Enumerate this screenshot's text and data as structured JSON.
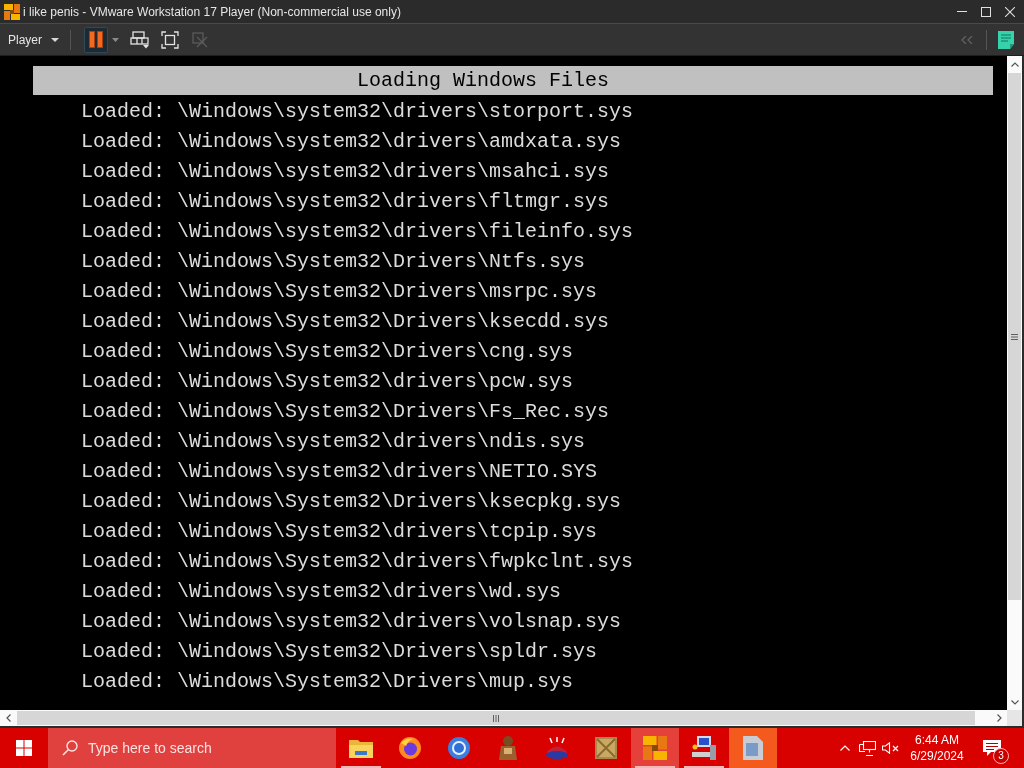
{
  "window": {
    "title": "i like penis - VMware Workstation 17 Player (Non-commercial use only)"
  },
  "toolbar": {
    "menu_label": "Player",
    "buttons": [
      {
        "kind": "pause",
        "selected": true,
        "disabled": false
      },
      {
        "kind": "send-keys",
        "selected": false,
        "disabled": false
      },
      {
        "kind": "fullscreen",
        "selected": false,
        "disabled": false
      },
      {
        "kind": "unity",
        "selected": false,
        "disabled": true
      }
    ],
    "right_buttons": [
      {
        "kind": "collapse",
        "disabled": true
      },
      {
        "kind": "notes",
        "disabled": false
      }
    ]
  },
  "console": {
    "header": "Loading Windows Files",
    "lines": [
      "Loaded: \\Windows\\system32\\drivers\\storport.sys",
      "Loaded: \\Windows\\system32\\drivers\\amdxata.sys",
      "Loaded: \\Windows\\system32\\drivers\\msahci.sys",
      "Loaded: \\Windows\\system32\\drivers\\fltmgr.sys",
      "Loaded: \\Windows\\system32\\drivers\\fileinfo.sys",
      "Loaded: \\Windows\\System32\\Drivers\\Ntfs.sys",
      "Loaded: \\Windows\\System32\\Drivers\\msrpc.sys",
      "Loaded: \\Windows\\System32\\Drivers\\ksecdd.sys",
      "Loaded: \\Windows\\System32\\Drivers\\cng.sys",
      "Loaded: \\Windows\\System32\\drivers\\pcw.sys",
      "Loaded: \\Windows\\System32\\Drivers\\Fs_Rec.sys",
      "Loaded: \\Windows\\system32\\drivers\\ndis.sys",
      "Loaded: \\Windows\\system32\\drivers\\NETIO.SYS",
      "Loaded: \\Windows\\System32\\Drivers\\ksecpkg.sys",
      "Loaded: \\Windows\\System32\\drivers\\tcpip.sys",
      "Loaded: \\Windows\\System32\\drivers\\fwpkclnt.sys",
      "Loaded: \\Windows\\system32\\drivers\\wd.sys",
      "Loaded: \\Windows\\system32\\drivers\\volsnap.sys",
      "Loaded: \\Windows\\System32\\Drivers\\spldr.sys",
      "Loaded: \\Windows\\System32\\Drivers\\mup.sys"
    ]
  },
  "taskbar": {
    "search": {
      "placeholder": "Type here to search"
    },
    "apps": [
      {
        "kind": "folder",
        "running": true,
        "selected": false,
        "hovered": false
      },
      {
        "kind": "orb",
        "running": false,
        "selected": false,
        "hovered": false
      },
      {
        "kind": "ring",
        "running": false,
        "selected": false,
        "hovered": false
      },
      {
        "kind": "figure",
        "running": false,
        "selected": false,
        "hovered": false
      },
      {
        "kind": "dome",
        "running": false,
        "selected": false,
        "hovered": false
      },
      {
        "kind": "crate",
        "running": false,
        "selected": false,
        "hovered": false
      },
      {
        "kind": "pinwheel",
        "running": true,
        "selected": true,
        "hovered": false
      },
      {
        "kind": "computer",
        "running": true,
        "selected": false,
        "hovered": false
      },
      {
        "kind": "document",
        "running": false,
        "selected": false,
        "hovered": true
      }
    ],
    "tray": {
      "volume_muted": true
    },
    "clock": {
      "time": "6:44 AM",
      "date": "6/29/2024"
    },
    "notifications": {
      "count": "3"
    }
  }
}
